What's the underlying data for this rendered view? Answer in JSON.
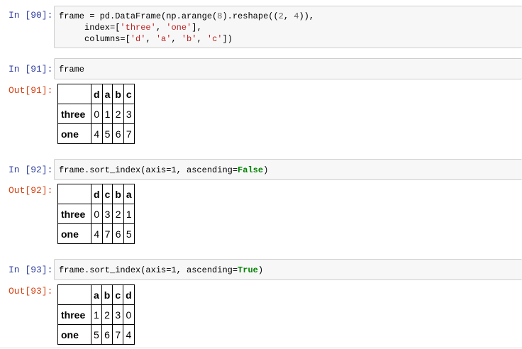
{
  "cells": [
    {
      "in_prompt": "In [90]:",
      "code_lines": [
        "frame = pd.DataFrame(np.arange(8).reshape((2, 4)),",
        "     index=['three', 'one'],",
        "     columns=['d', 'a', 'b', 'c'])"
      ]
    },
    {
      "in_prompt": "In [91]:",
      "code": "frame",
      "out_prompt": "Out[91]:",
      "table": {
        "columns": [
          "d",
          "a",
          "b",
          "c"
        ],
        "rows": [
          {
            "label": "three",
            "values": [
              "0",
              "1",
              "2",
              "3"
            ]
          },
          {
            "label": "one",
            "values": [
              "4",
              "5",
              "6",
              "7"
            ]
          }
        ]
      }
    },
    {
      "in_prompt": "In [92]:",
      "code_prefix": "frame.sort_index(axis=1, ascending=",
      "code_keyword": "False",
      "code_suffix": ")",
      "out_prompt": "Out[92]:",
      "table": {
        "columns": [
          "d",
          "c",
          "b",
          "a"
        ],
        "rows": [
          {
            "label": "three",
            "values": [
              "0",
              "3",
              "2",
              "1"
            ]
          },
          {
            "label": "one",
            "values": [
              "4",
              "7",
              "6",
              "5"
            ]
          }
        ]
      }
    },
    {
      "in_prompt": "In [93]:",
      "code_prefix": "frame.sort_index(axis=1, ascending=",
      "code_keyword": "True",
      "code_suffix": ")",
      "out_prompt": "Out[93]:",
      "table": {
        "columns": [
          "a",
          "b",
          "c",
          "d"
        ],
        "rows": [
          {
            "label": "three",
            "values": [
              "1",
              "2",
              "3",
              "0"
            ]
          },
          {
            "label": "one",
            "values": [
              "5",
              "6",
              "7",
              "4"
            ]
          }
        ]
      }
    }
  ]
}
